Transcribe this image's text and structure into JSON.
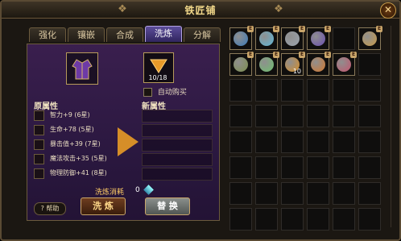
{
  "window": {
    "title": "铁匠铺",
    "close": "✕"
  },
  "tabs": [
    {
      "label": "强化"
    },
    {
      "label": "镶嵌"
    },
    {
      "label": "合成"
    },
    {
      "label": "洗炼"
    },
    {
      "label": "分解"
    }
  ],
  "refine": {
    "material_count": "10/18",
    "auto_buy": "自动购买",
    "original_header": "原属性",
    "new_header": "新属性",
    "original_attrs": [
      "智力+9 (6星)",
      "生命+78 (5星)",
      "暴击值+39 (7星)",
      "魔法攻击+35 (5星)",
      "物理防御+41 (8星)"
    ],
    "cost_label": "洗炼消耗",
    "cost_value": "0",
    "help": "帮助",
    "wash_button": "洗 炼",
    "swap_button": "替 换"
  },
  "inventory": {
    "badge_letter": "E",
    "items": [
      {
        "name": "blue-ring",
        "color": "#3b7ab8"
      },
      {
        "name": "blue-gauntlet",
        "color": "#5fb7d8"
      },
      {
        "name": "silver-necklace",
        "color": "#9aa3ad"
      },
      {
        "name": "purple-hat",
        "color": "#6a4fb0"
      },
      {
        "name": "empty",
        "color": ""
      },
      {
        "name": "staff",
        "color": "#c79a4a"
      },
      {
        "name": "amulet",
        "color": "#7c8d4f"
      },
      {
        "name": "green-charm",
        "color": "#6fbf6f"
      },
      {
        "name": "refine-stone",
        "color": "#d68e28",
        "count": "10"
      },
      {
        "name": "orange-orb",
        "color": "#d1782f"
      },
      {
        "name": "mask",
        "color": "#c4566f"
      }
    ]
  }
}
